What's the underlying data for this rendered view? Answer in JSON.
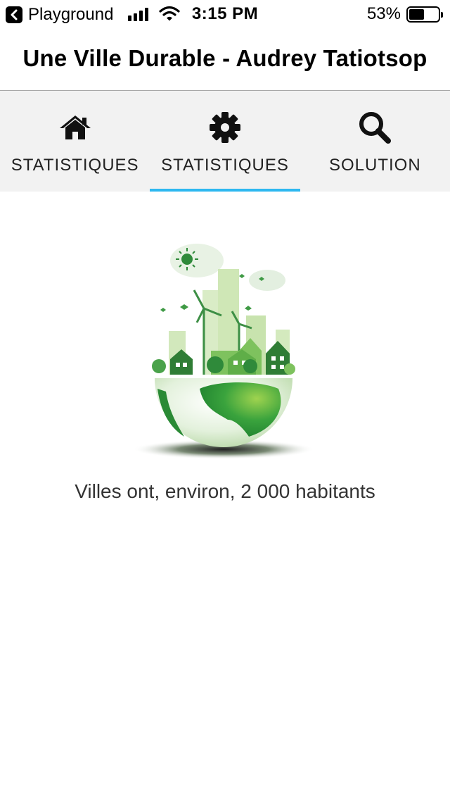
{
  "status_bar": {
    "back_app": "Playground",
    "time": "3:15 PM",
    "battery_percent": "53%",
    "battery_level": 0.53
  },
  "header": {
    "title": "Une Ville Durable - Audrey Tatiotsop"
  },
  "tabs": [
    {
      "label": "STATISTIQUES",
      "icon": "home-icon",
      "active": false
    },
    {
      "label": "STATISTIQUES",
      "icon": "gear-icon",
      "active": true
    },
    {
      "label": "SOLUTION",
      "icon": "search-icon",
      "active": false
    }
  ],
  "colors": {
    "accent": "#2eb8f0",
    "tabbar_bg": "#f2f2f2",
    "green": "#2e9e3e"
  },
  "content": {
    "caption": "Villes ont, environ, 2 000 habitants",
    "image": "eco-city-globe-illustration"
  }
}
